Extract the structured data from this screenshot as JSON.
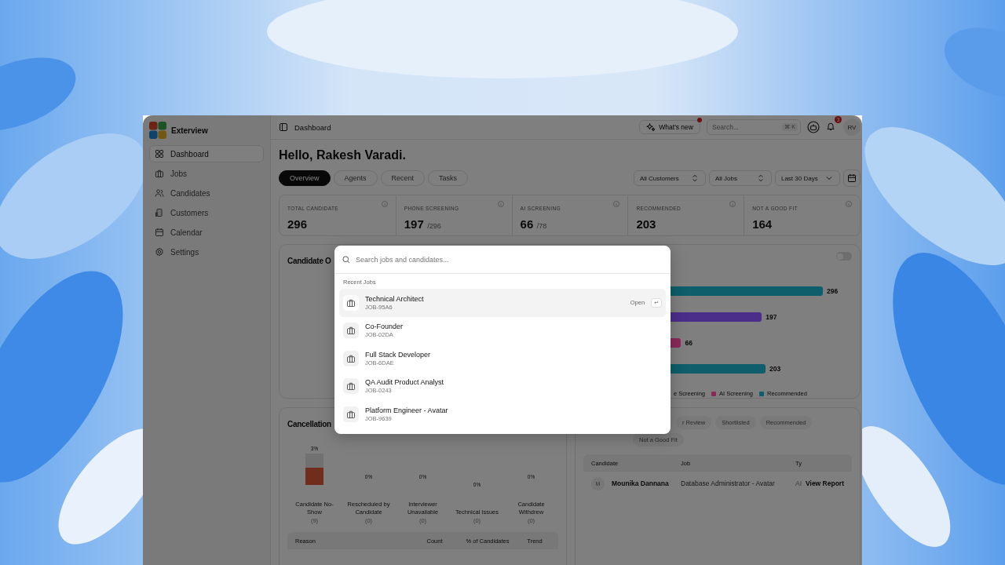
{
  "app": {
    "name": "Exterview"
  },
  "sidebar": {
    "items": [
      {
        "label": "Dashboard",
        "selected": true
      },
      {
        "label": "Jobs",
        "selected": false
      },
      {
        "label": "Candidates",
        "selected": false
      },
      {
        "label": "Customers",
        "selected": false
      },
      {
        "label": "Calendar",
        "selected": false
      },
      {
        "label": "Settings",
        "selected": false
      }
    ]
  },
  "topbar": {
    "breadcrumb": "Dashboard",
    "whats_new": {
      "label": "What's new",
      "unread": true
    },
    "search": {
      "placeholder": "Search...",
      "shortcut": "⌘ K"
    },
    "notifications": {
      "count": "3"
    },
    "avatar": "RV"
  },
  "greeting": "Hello, Rakesh Varadi.",
  "tabs": [
    {
      "label": "Overview",
      "selected": true
    },
    {
      "label": "Agents",
      "selected": false
    },
    {
      "label": "Recent",
      "selected": false
    },
    {
      "label": "Tasks",
      "selected": false
    }
  ],
  "filters": [
    {
      "label": "All Customers",
      "kind": "select"
    },
    {
      "label": "All Jobs",
      "kind": "select"
    },
    {
      "label": "Last 30 Days",
      "kind": "dropdown"
    }
  ],
  "stats": [
    {
      "label": "TOTAL CANDIDATE",
      "value": "296"
    },
    {
      "label": "PHONE SCREENING",
      "value": "197",
      "total": "/296"
    },
    {
      "label": "AI SCREENING",
      "value": "66",
      "total": "/78"
    },
    {
      "label": "RECOMMENDED",
      "value": "203"
    },
    {
      "label": "NOT A GOOD FIT",
      "value": "164"
    }
  ],
  "candidate_overview": {
    "title": "Candidate O",
    "toggle_on": false,
    "bars": [
      {
        "value": "296",
        "color": "#0e5e6b"
      },
      {
        "value": "197",
        "color": "#4b2e8a"
      },
      {
        "value": "66",
        "color": "#8a2a5a"
      },
      {
        "value": "203",
        "color": "#0e5e6b"
      }
    ],
    "legend": [
      {
        "label": "e Screening"
      },
      {
        "label": "AI Screening",
        "color": "#8a2a5a"
      },
      {
        "label": "Recommended",
        "color": "#0e5e6b"
      }
    ]
  },
  "cancellation": {
    "title": "Cancellation",
    "reasons": [
      {
        "percent": "3%",
        "level": 0.55,
        "label": "Candidate No-Show",
        "count": "(9)"
      },
      {
        "percent": "0%",
        "label": "Rescheduled by Candidate",
        "count": "(0)"
      },
      {
        "percent": "0%",
        "label": "Interviewer Unavailable",
        "count": "(0)"
      },
      {
        "percent": "0%",
        "label": "Technical Issues",
        "count": "(0)"
      },
      {
        "percent": "0%",
        "label": "Candidate Withdrew",
        "count": "(0)"
      }
    ],
    "table": {
      "columns": [
        "Reason",
        "Count",
        "% of Candidates",
        "Trend"
      ]
    }
  },
  "candidates_panel": {
    "filters": [
      {
        "label": "r Review",
        "selected": false
      },
      {
        "label": "Shortlisted",
        "selected": false
      },
      {
        "label": "Recommended",
        "selected": false
      },
      {
        "label": "Not a Good Fit",
        "selected": false
      }
    ],
    "table": {
      "columns": [
        "Candidate",
        "Job",
        "Ty"
      ],
      "rows": [
        {
          "initial": "M",
          "name": "Mounika Dannana",
          "job": "Database Administrator - Avatar",
          "type": "AI",
          "action": "View Report"
        }
      ]
    }
  },
  "search_dialog": {
    "placeholder": "Search jobs and candidates...",
    "section": "Recent Jobs",
    "open_hint": "Open",
    "enter_key": "↵",
    "items": [
      {
        "title": "Technical Architect",
        "code": "JOB-95A6",
        "selected": true
      },
      {
        "title": "Co-Founder",
        "code": "JOB-02DA",
        "selected": false
      },
      {
        "title": "Full Stack Developer",
        "code": "JOB-6DAE",
        "selected": false
      },
      {
        "title": "QA Audit Product Analyst",
        "code": "JOB-0243",
        "selected": false
      },
      {
        "title": "Platform Engineer - Avatar",
        "code": "JOB-9639",
        "selected": false
      }
    ]
  }
}
